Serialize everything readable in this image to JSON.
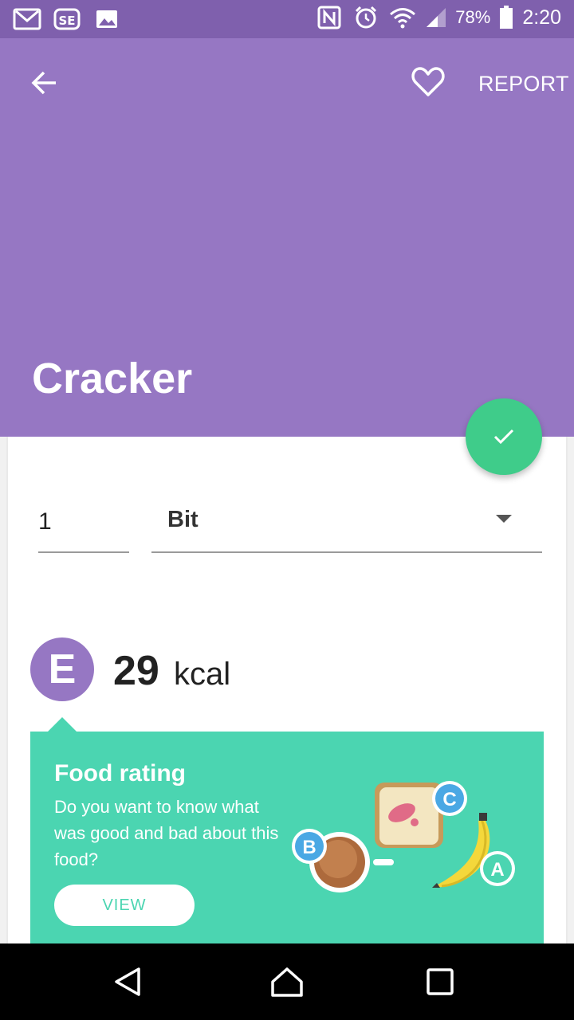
{
  "status_bar": {
    "battery": "78%",
    "time": "2:20",
    "icons": [
      "gmail-icon",
      "contacts-icon",
      "image-icon",
      "nfc-icon",
      "alarm-icon",
      "wifi-icon",
      "signal-icon",
      "battery-icon"
    ]
  },
  "header": {
    "back_icon": "arrow-left-icon",
    "favorite_icon": "heart-icon",
    "report_label": "REPORT",
    "title": "Cracker",
    "color": "#9677c3"
  },
  "fab": {
    "icon": "check-icon",
    "color": "#3fcc8a"
  },
  "serving": {
    "quantity": "1",
    "unit": "Bit"
  },
  "nutrition": {
    "grade": "E",
    "kcal_value": "29",
    "kcal_unit": "kcal"
  },
  "food_rating": {
    "title": "Food rating",
    "description": "Do you want to know what was good and bad about this food?",
    "button_label": "VIEW",
    "illustration_labels": [
      "A",
      "B",
      "C"
    ],
    "color": "#4bd5b1"
  },
  "nav_bar": {
    "icons": [
      "back-triangle-icon",
      "home-icon",
      "recents-icon"
    ]
  }
}
